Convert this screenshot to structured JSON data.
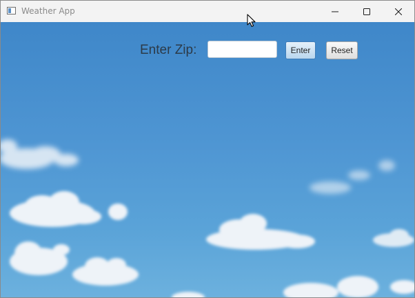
{
  "window": {
    "title": "Weather App",
    "icon": "app-window-icon",
    "controls": [
      "minimize-icon",
      "maximize-icon",
      "close-icon"
    ]
  },
  "background": {
    "description_colors": {
      "sky_top": "#3f87c9",
      "sky_bottom": "#6cb1de",
      "cloud": "#f2f5f8"
    }
  },
  "form": {
    "zip_label": "Enter Zip:",
    "zip_value": "",
    "zip_placeholder": "",
    "enter_label": "Enter",
    "reset_label": "Reset"
  },
  "colors": {
    "enter_border": "#3e7cb8",
    "title_text": "#8a8a8a"
  }
}
